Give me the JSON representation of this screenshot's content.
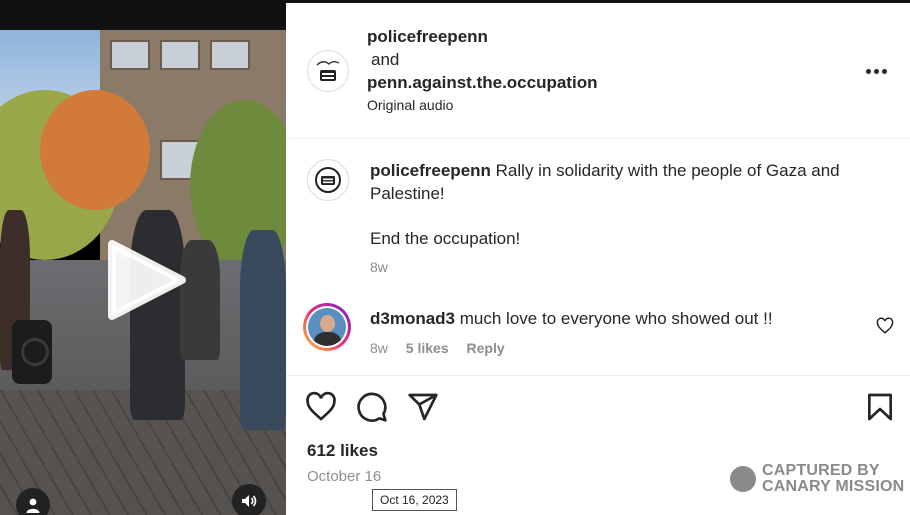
{
  "header": {
    "user1": "policefreepenn",
    "joiner": "and",
    "user2": "penn.against.the.occupation",
    "audio": "Original audio"
  },
  "caption": {
    "user": "policefreepenn",
    "text": "Rally in solidarity with the people of Gaza and Palestine!",
    "text2": "End the occupation!",
    "time": "8w"
  },
  "comment": {
    "user": "d3monad3",
    "text": "much love to everyone who showed out !!",
    "time": "8w",
    "likes": "5 likes",
    "reply": "Reply"
  },
  "post": {
    "likes": "612 likes",
    "date": "October 16",
    "tooltip": "Oct 16, 2023"
  },
  "watermark": {
    "line1": "CAPTURED BY",
    "line2": "CANARY MISSION"
  },
  "icons": {
    "play": "play-icon",
    "user": "user-icon",
    "sound": "sound-icon",
    "more": "more-options-icon",
    "like": "heart-icon",
    "comment": "comment-icon",
    "share": "share-icon",
    "save": "bookmark-icon"
  }
}
